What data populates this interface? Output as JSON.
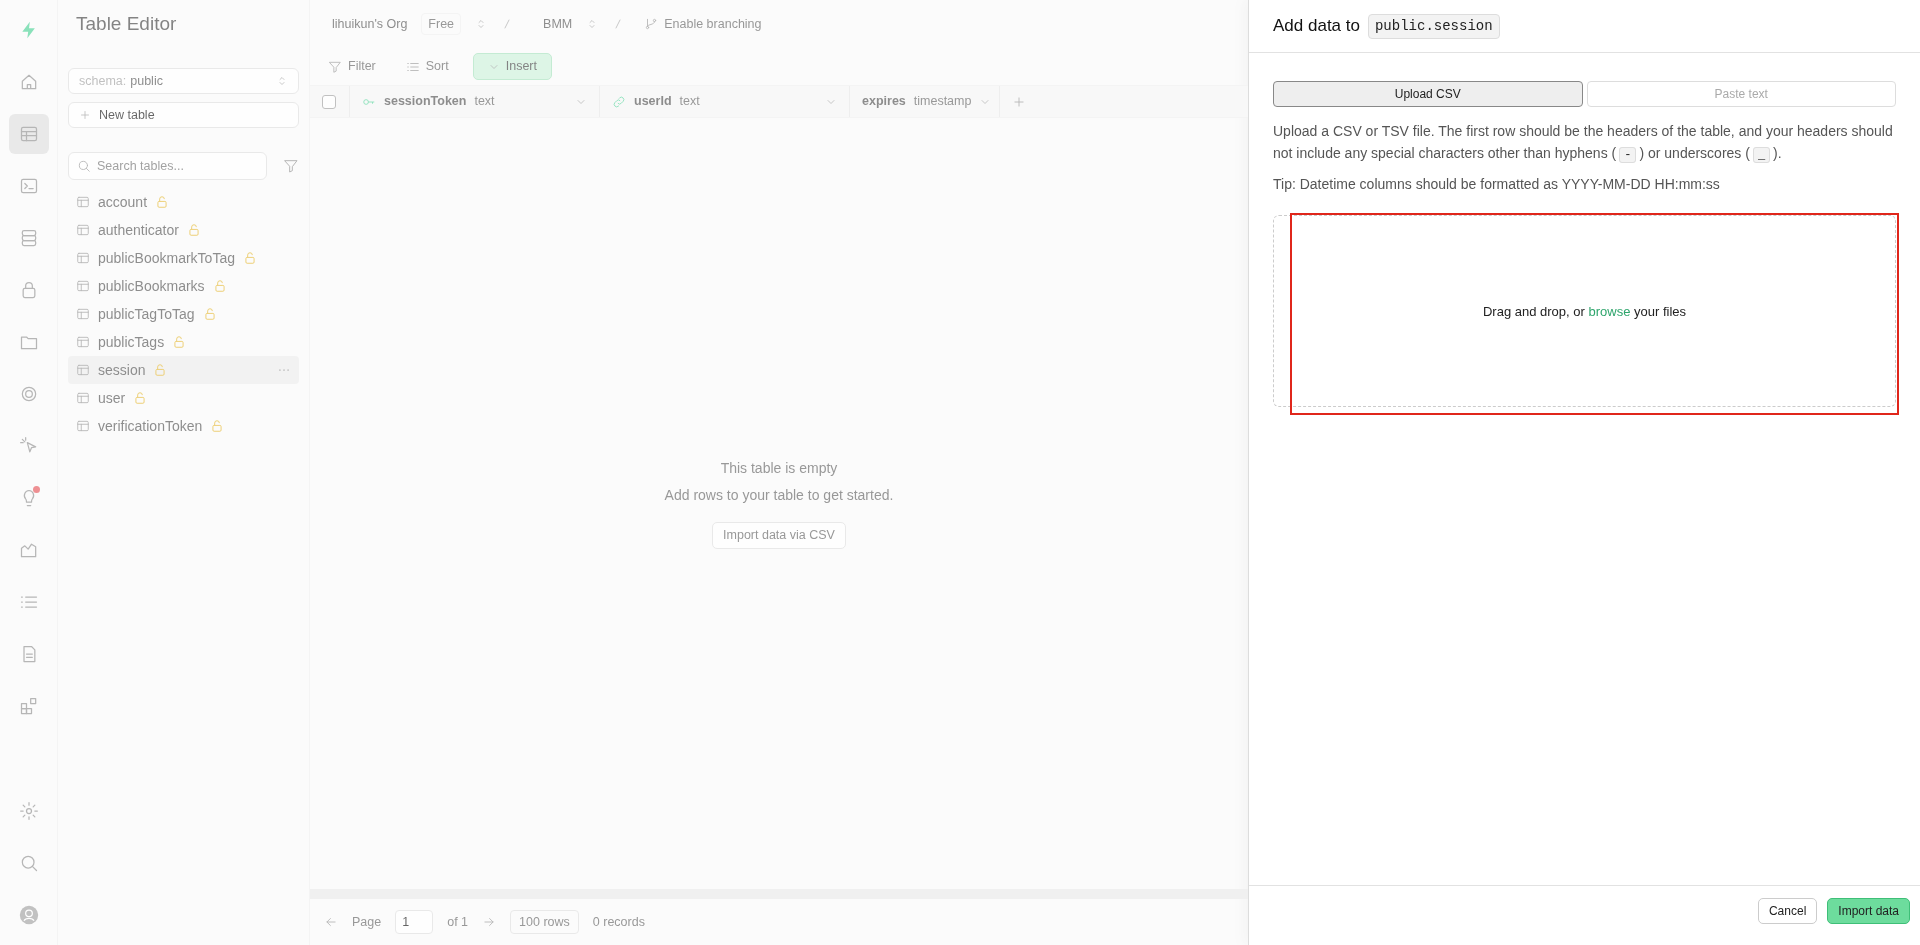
{
  "nav_rail": {
    "items": [
      {
        "kind": "logo",
        "selected": false,
        "alert": false
      },
      {
        "kind": "home",
        "selected": false,
        "alert": false
      },
      {
        "kind": "table",
        "selected": true,
        "alert": false
      },
      {
        "kind": "terminal",
        "selected": false,
        "alert": false
      },
      {
        "kind": "database",
        "selected": false,
        "alert": false
      },
      {
        "kind": "lock",
        "selected": false,
        "alert": false
      },
      {
        "kind": "folder",
        "selected": false,
        "alert": false
      },
      {
        "kind": "rings",
        "selected": false,
        "alert": false
      },
      {
        "kind": "cursor",
        "selected": false,
        "alert": false
      },
      {
        "kind": "bulb",
        "selected": false,
        "alert": true
      },
      {
        "kind": "chart",
        "selected": false,
        "alert": false
      },
      {
        "kind": "list",
        "selected": false,
        "alert": false
      },
      {
        "kind": "document",
        "selected": false,
        "alert": false
      },
      {
        "kind": "blocks",
        "selected": false,
        "alert": false
      },
      {
        "kind": "gear",
        "selected": false,
        "alert": false
      },
      {
        "kind": "search",
        "selected": false,
        "alert": false
      },
      {
        "kind": "avatar",
        "selected": false,
        "alert": false
      }
    ]
  },
  "page_title": "Table Editor",
  "breadcrumb": {
    "org": "lihuikun's Org",
    "plan": "Free",
    "project": "BMM",
    "branching": "Enable branching"
  },
  "sidebar": {
    "schema_label": "schema:",
    "schema_value": "public",
    "new_table": "New table",
    "search": {
      "placeholder": "Search tables..."
    },
    "tables": [
      {
        "name": "account",
        "selected": false
      },
      {
        "name": "authenticator",
        "selected": false
      },
      {
        "name": "publicBookmarkToTag",
        "selected": false
      },
      {
        "name": "publicBookmarks",
        "selected": false
      },
      {
        "name": "publicTagToTag",
        "selected": false
      },
      {
        "name": "publicTags",
        "selected": false
      },
      {
        "name": "session",
        "selected": true
      },
      {
        "name": "user",
        "selected": false
      },
      {
        "name": "verificationToken",
        "selected": false
      }
    ]
  },
  "toolbar": {
    "filter": "Filter",
    "sort": "Sort",
    "insert": "Insert"
  },
  "select_all": {
    "checked": false
  },
  "columns": [
    {
      "name": "sessionToken",
      "type": "text",
      "kind": "primary_key"
    },
    {
      "name": "userId",
      "type": "text",
      "kind": "foreign_key"
    },
    {
      "name": "expires",
      "type": "timestamp",
      "kind": "plain"
    }
  ],
  "empty_state": {
    "title": "This table is empty",
    "subtitle": "Add rows to your table to get started.",
    "button": "Import data via CSV"
  },
  "pagination": {
    "page_label": "Page",
    "page": "1",
    "of": "of 1",
    "rows": "100 rows",
    "records": "0 records"
  },
  "panel": {
    "title": "Add data to",
    "table": "public.session",
    "tabs": [
      {
        "label": "Upload CSV",
        "selected": true
      },
      {
        "label": "Paste text",
        "selected": false
      }
    ],
    "description": [
      {
        "kind": "text",
        "text": "Upload a CSV or TSV file. The first row should be the headers of the table, and your headers should not include any special characters other than hyphens ("
      },
      {
        "kind": "code",
        "text": "-"
      },
      {
        "kind": "text",
        "text": ") or underscores ("
      },
      {
        "kind": "code",
        "text": "_"
      },
      {
        "kind": "text",
        "text": ")."
      }
    ],
    "tip": "Tip: Datetime columns should be formatted as YYYY-MM-DD HH:mm:ss",
    "dropzone": {
      "before": "Drag and drop, or",
      "link": "browse",
      "after": "your files",
      "highlighted": true
    },
    "buttons": [
      {
        "label": "Cancel",
        "kind": "secondary"
      },
      {
        "label": "Import data",
        "kind": "primary"
      }
    ]
  }
}
